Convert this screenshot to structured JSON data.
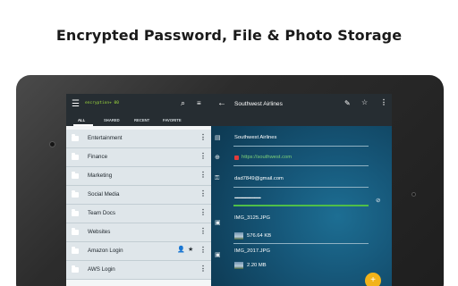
{
  "headline": "Encrypted Password, File & Photo Storage",
  "left_pane": {
    "brand": "encryption+ 00",
    "tabs": [
      "ALL",
      "SHARED",
      "RECENT",
      "FAVORITE"
    ],
    "items": [
      {
        "label": "Entertainment"
      },
      {
        "label": "Finance"
      },
      {
        "label": "Marketing"
      },
      {
        "label": "Social Media"
      },
      {
        "label": "Team Docs"
      },
      {
        "label": "Websites"
      },
      {
        "label": "Amazon Login"
      },
      {
        "label": "AWS Login"
      }
    ]
  },
  "right_pane": {
    "title": "Southwest Airlines",
    "name_value": "Southwest Airlines",
    "url_value": "https://southwest.com",
    "username_value": "dad7849@gmail.com",
    "password_mask": "••••••••••••••••••••••••••••••",
    "files": [
      {
        "name": "IMG_3125.JPG",
        "size": "576.64 KB"
      },
      {
        "name": "IMG_2017.JPG",
        "size": "2.20 MB"
      }
    ],
    "fab_label": "+"
  },
  "icons": {
    "menu": "☰",
    "search": "⌕",
    "list": "≡",
    "more": "⋮",
    "back": "←",
    "edit": "✎",
    "star": "☆",
    "star_filled": "★",
    "person": "👤",
    "doc": "▤",
    "globe": "⊕",
    "key": "⚿",
    "image": "▣",
    "eye_off": "⊘"
  },
  "colors": {
    "accent": "#f2b31a",
    "url_green": "#7ed27b",
    "password_bar": "#4fbf48",
    "brand_green": "#9fdc3e"
  }
}
